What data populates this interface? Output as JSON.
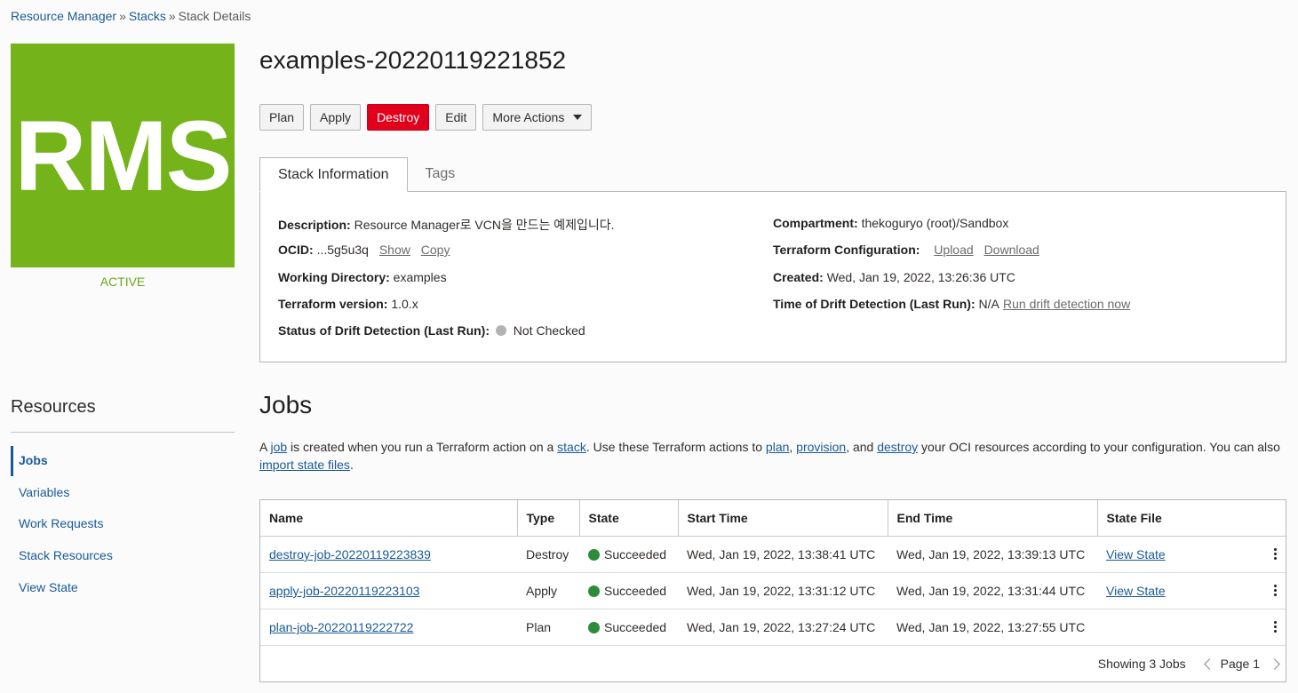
{
  "breadcrumb": {
    "items": [
      "Resource Manager",
      "Stacks"
    ],
    "current": "Stack Details",
    "separator": "»"
  },
  "stack": {
    "logo_text": "RMS",
    "lifecycle_state": "ACTIVE",
    "title": "examples-20220119221852"
  },
  "actions": {
    "plan": "Plan",
    "apply": "Apply",
    "destroy": "Destroy",
    "edit": "Edit",
    "more": "More Actions"
  },
  "tabs": {
    "info": "Stack Information",
    "tags": "Tags"
  },
  "info": {
    "description_label": "Description:",
    "description": "Resource Manager로 VCN을 만드는 예제입니다.",
    "ocid_label": "OCID:",
    "ocid": "...5g5u3q",
    "show": "Show",
    "copy": "Copy",
    "workdir_label": "Working Directory:",
    "workdir": "examples",
    "tfver_label": "Terraform version:",
    "tfver": "1.0.x",
    "drift_status_label": "Status of Drift Detection (Last Run):",
    "drift_status": "Not Checked",
    "compartment_label": "Compartment:",
    "compartment": "thekoguryo (root)/Sandbox",
    "tfconfig_label": "Terraform Configuration:",
    "upload": "Upload",
    "download": "Download",
    "created_label": "Created:",
    "created": "Wed, Jan 19, 2022, 13:26:36 UTC",
    "drift_time_label": "Time of Drift Detection (Last Run):",
    "drift_time": "N/A",
    "run_drift": "Run drift detection now"
  },
  "resources": {
    "title": "Resources",
    "items": [
      "Jobs",
      "Variables",
      "Work Requests",
      "Stack Resources",
      "View State"
    ]
  },
  "jobs": {
    "title": "Jobs",
    "desc": {
      "t1": "A ",
      "l1": "job",
      "t2": " is created when you run a Terraform action on a ",
      "l2": "stack",
      "t3": ". Use these Terraform actions to ",
      "l3": "plan",
      "t4": ", ",
      "l4": "provision",
      "t5": ", and ",
      "l5": "destroy",
      "t6": " your OCI resources according to your configuration. You can also ",
      "l6": "import state files",
      "t7": "."
    },
    "columns": [
      "Name",
      "Type",
      "State",
      "Start Time",
      "End Time",
      "State File"
    ],
    "rows": [
      {
        "name": "destroy-job-20220119223839",
        "type": "Destroy",
        "state": "Succeeded",
        "start": "Wed, Jan 19, 2022, 13:38:41 UTC",
        "end": "Wed, Jan 19, 2022, 13:39:13 UTC",
        "state_file": "View State"
      },
      {
        "name": "apply-job-20220119223103",
        "type": "Apply",
        "state": "Succeeded",
        "start": "Wed, Jan 19, 2022, 13:31:12 UTC",
        "end": "Wed, Jan 19, 2022, 13:31:44 UTC",
        "state_file": "View State"
      },
      {
        "name": "plan-job-20220119222722",
        "type": "Plan",
        "state": "Succeeded",
        "start": "Wed, Jan 19, 2022, 13:27:24 UTC",
        "end": "Wed, Jan 19, 2022, 13:27:55 UTC",
        "state_file": ""
      }
    ],
    "showing": "Showing 3 Jobs",
    "page": "Page 1"
  },
  "colors": {
    "logo": "#74b31a",
    "destroy": "#e0001b",
    "success": "#2e8b3a",
    "link": "#1a5a96"
  }
}
